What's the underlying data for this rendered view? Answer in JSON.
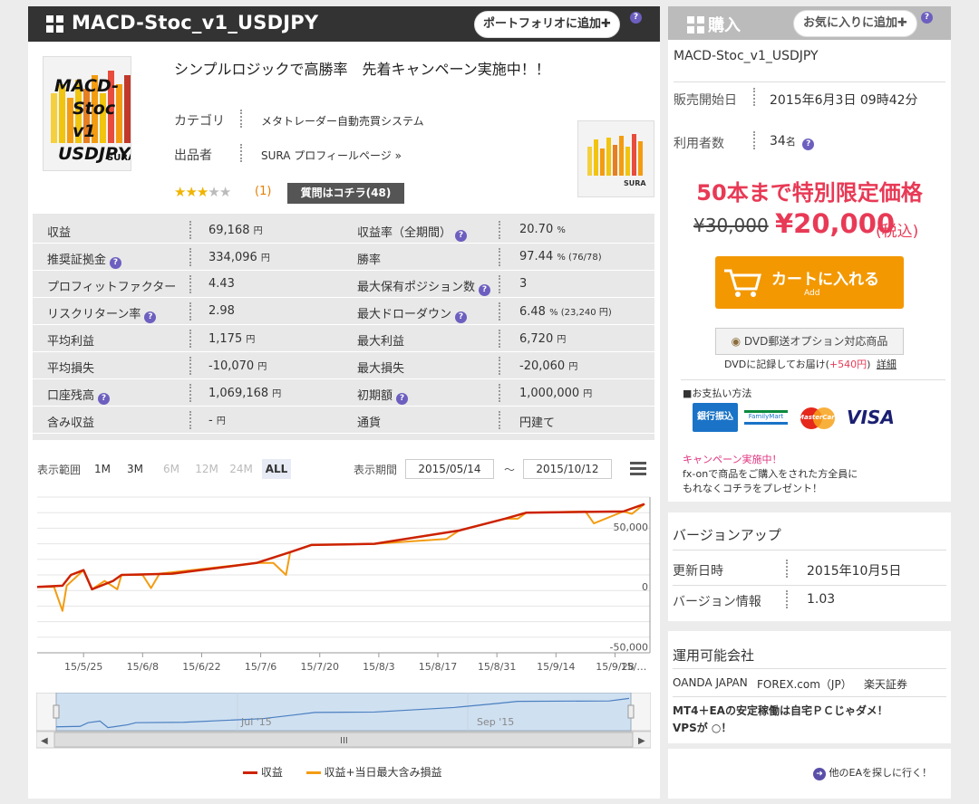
{
  "product": {
    "title": "MACD-Stoc_v1_USDJPY",
    "add_portfolio": "ポートフォリオに追加",
    "help": "?",
    "logo_line1": "MACD-",
    "logo_line2": "Stoc v1",
    "logo_line3": "USDJPY",
    "logo_brand": "SURA",
    "small_logo_brand": "SURA",
    "headline": "シンプルロジックで高勝率　先着キャンペーン実施中！！",
    "category_label": "カテゴリ",
    "category_value": "メタトレーダー自動売買システム",
    "seller_label": "出品者",
    "seller_value": "SURA プロフィールページ »",
    "rating_count": "(1)",
    "question_button": "質問はコチラ(48)",
    "rating": 3
  },
  "stats": [
    {
      "l1": "収益",
      "v1": "69,168",
      "u1": "円",
      "l2": "収益率（全期間）",
      "v2": "20.70",
      "u2": "%",
      "h1": false,
      "h2": true
    },
    {
      "l1": "推奨証拠金",
      "v1": "334,096",
      "u1": "円",
      "l2": "勝率",
      "v2": "97.44",
      "u2": "% (76/78)",
      "h1": true,
      "h2": false
    },
    {
      "l1": "プロフィットファクター",
      "v1": "4.43",
      "u1": "",
      "l2": "最大保有ポジション数",
      "v2": "3",
      "u2": "",
      "h1": false,
      "h2": true
    },
    {
      "l1": "リスクリターン率",
      "v1": "2.98",
      "u1": "",
      "l2": "最大ドローダウン",
      "v2": "6.48",
      "u2": "% (23,240 円)",
      "h1": true,
      "h2": true
    },
    {
      "l1": "平均利益",
      "v1": "1,175",
      "u1": "円",
      "l2": "最大利益",
      "v2": "6,720",
      "u2": "円",
      "h1": false,
      "h2": false
    },
    {
      "l1": "平均損失",
      "v1": "-10,070",
      "u1": "円",
      "l2": "最大損失",
      "v2": "-20,060",
      "u2": "円",
      "h1": false,
      "h2": false
    },
    {
      "l1": "口座残高",
      "v1": "1,069,168",
      "u1": "円",
      "l2": "初期額",
      "v2": "1,000,000",
      "u2": "円",
      "h1": true,
      "h2": true
    },
    {
      "l1": "含み収益",
      "v1": "-",
      "u1": "円",
      "l2": "通貨",
      "v2": "円建て",
      "u2": "",
      "h1": false,
      "h2": false
    }
  ],
  "chart_controls": {
    "range_label": "表示範囲",
    "ranges": [
      "1M",
      "3M",
      "6M",
      "12M",
      "24M",
      "ALL"
    ],
    "period_label": "表示期間",
    "from_date": "2015/05/14",
    "tilde": "〜",
    "to_date": "2015/10/12"
  },
  "chart_data": {
    "type": "line",
    "x_tick_labels": [
      "15/5/25",
      "15/6/8",
      "15/6/22",
      "15/7/6",
      "15/7/20",
      "15/8/3",
      "15/8/17",
      "15/8/31",
      "15/9/14",
      "15/9/28",
      "15/…"
    ],
    "y_tick_labels": [
      "50,000",
      "0",
      "-50,000"
    ],
    "ylim": [
      -55000,
      75000
    ],
    "navigator_labels": [
      "Jul '15",
      "Sep '15"
    ],
    "legend": [
      "収益",
      "収益+当日最大含み損益"
    ],
    "series": [
      {
        "name": "収益",
        "color": "#cc2200",
        "points": [
          [
            0,
            0
          ],
          [
            6,
            1000
          ],
          [
            8,
            10000
          ],
          [
            11,
            14000
          ],
          [
            13,
            -2000
          ],
          [
            18,
            5000
          ],
          [
            20,
            10000
          ],
          [
            32,
            11000
          ],
          [
            52,
            20000
          ],
          [
            60,
            29000
          ],
          [
            65,
            35000
          ],
          [
            80,
            36000
          ],
          [
            100,
            47000
          ],
          [
            111,
            57000
          ],
          [
            116,
            62000
          ],
          [
            139,
            63000
          ],
          [
            144,
            69168
          ]
        ]
      },
      {
        "name": "収益+当日最大含み損益",
        "color": "#f39c12",
        "points": [
          [
            0,
            0
          ],
          [
            4,
            0
          ],
          [
            6,
            -20000
          ],
          [
            7,
            1000
          ],
          [
            11,
            14000
          ],
          [
            13,
            -2000
          ],
          [
            16,
            5000
          ],
          [
            19,
            -2000
          ],
          [
            20,
            10000
          ],
          [
            25,
            10000
          ],
          [
            27,
            -1000
          ],
          [
            29,
            11000
          ],
          [
            52,
            20000
          ],
          [
            56,
            20000
          ],
          [
            59,
            10000
          ],
          [
            60,
            29000
          ],
          [
            65,
            35000
          ],
          [
            80,
            36000
          ],
          [
            97,
            40000
          ],
          [
            100,
            47000
          ],
          [
            111,
            57000
          ],
          [
            114,
            57000
          ],
          [
            116,
            62000
          ],
          [
            130,
            63000
          ],
          [
            132,
            53000
          ],
          [
            139,
            63000
          ],
          [
            141,
            61000
          ],
          [
            144,
            69168
          ]
        ]
      }
    ]
  },
  "buy": {
    "header": "購入",
    "favorite": "お気に入りに追加",
    "product_name": "MACD-Stoc_v1_USDJPY",
    "sale_start_label": "販売開始日",
    "sale_start_value": "2015年6月3日 09時42分",
    "users_label": "利用者数",
    "users_value": "34",
    "users_unit": "名",
    "promo": "50本まで特別限定価格",
    "old_price": "¥30,000",
    "new_price": "¥20,000",
    "tax": "(税込)",
    "cart_button": "カートに入れる",
    "cart_sub": "Add",
    "dvd_button": "DVD郵送オプション対応商品",
    "dvd_note": "DVDに記録してお届け(",
    "dvd_price": "+540円",
    "dvd_note_end": ")",
    "dvd_detail": "詳細",
    "payment_label": "■お支払い方法",
    "pay_bank": "銀行振込",
    "pay_familymart": "FamilyMart",
    "pay_mastercard": "MasterCard",
    "pay_visa": "VISA",
    "campaign_title": "キャンペーン実施中！",
    "campaign_text1": "fx-onで商品をご購入をされた方全員に",
    "campaign_text2": "もれなくコチラをプレゼント！"
  },
  "version": {
    "header": "バージョンアップ",
    "updated_label": "更新日時",
    "updated_value": "2015年10月5日",
    "version_label": "バージョン情報",
    "version_value": "1.03"
  },
  "brokers": {
    "header": "運用可能会社",
    "list": [
      "OANDA JAPAN",
      "FOREX.com（JP）",
      "楽天証券"
    ],
    "vps_line1": "MT4＋EAの安定稼働は自宅ＰＣじゃダメ！",
    "vps_line2": "VPSが ○！",
    "other_ea": "他のEAを探しに行く！"
  },
  "colors": {
    "accent_red": "#e83a56",
    "cart_orange": "#f39800",
    "header_dark": "#333333",
    "help_purple": "#6c5fbf"
  }
}
